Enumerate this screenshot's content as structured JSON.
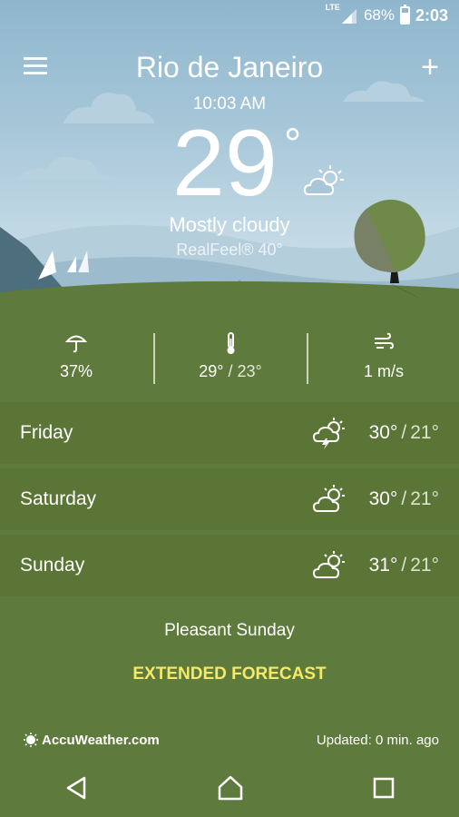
{
  "status_bar": {
    "network": "LTE",
    "battery_percent": "68%",
    "battery_level": 0.68,
    "time": "2:03"
  },
  "header": {
    "city": "Rio de Janeiro",
    "local_time": "10:03 AM"
  },
  "current": {
    "temperature": "29",
    "degree_symbol": "°",
    "condition": "Mostly cloudy",
    "realfeel": "RealFeel® 40°",
    "condition_icon": "partly-cloudy-icon"
  },
  "stats": {
    "precipitation": "37%",
    "temp_high": "29°",
    "temp_low": "/ 23°",
    "wind": "1 m/s"
  },
  "forecast": [
    {
      "day": "Friday",
      "icon": "thunderstorm-icon",
      "high": "30°",
      "low": "21°"
    },
    {
      "day": "Saturday",
      "icon": "partly-cloudy-icon",
      "high": "30°",
      "low": "21°"
    },
    {
      "day": "Sunday",
      "icon": "partly-cloudy-icon",
      "high": "31°",
      "low": "21°"
    }
  ],
  "separator": "/",
  "summary": "Pleasant Sunday",
  "extended_forecast": "EXTENDED FORECAST",
  "footer": {
    "brand": "AccuWeather.com",
    "updated": "Updated: 0 min. ago"
  },
  "colors": {
    "accent_yellow": "#f5e96a",
    "grass_green": "#5e7a3c",
    "row_green": "#5a7535",
    "sky_blue": "#a7c7d9"
  }
}
